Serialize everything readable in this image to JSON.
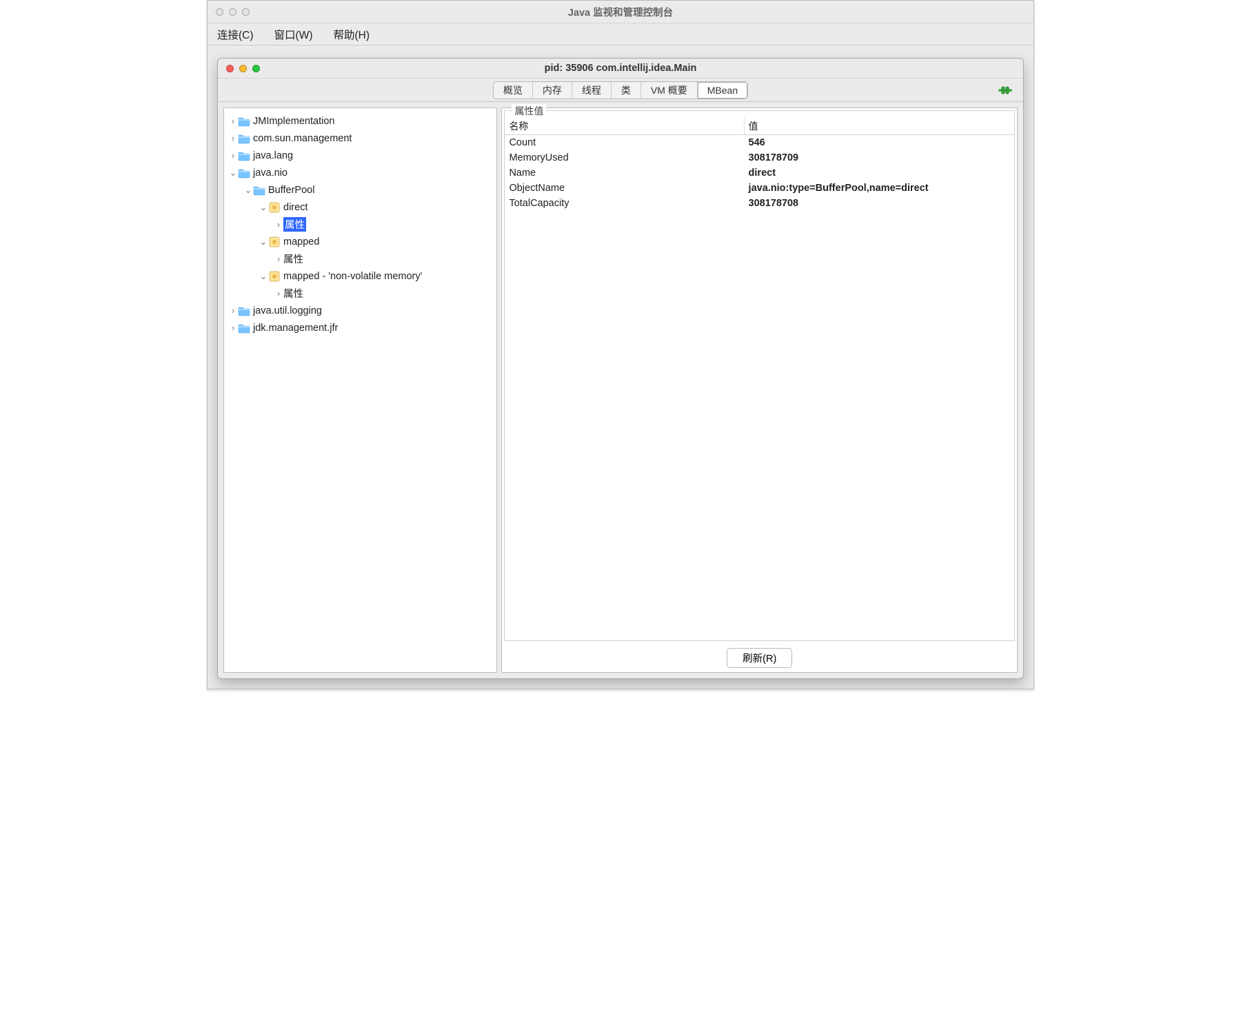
{
  "outerWindow": {
    "title": "Java 监视和管理控制台"
  },
  "menubar": {
    "connect": "连接(C)",
    "window": "窗口(W)",
    "help": "帮助(H)"
  },
  "innerWindow": {
    "title": "pid: 35906 com.intellij.idea.Main"
  },
  "tabs": {
    "overview": "概览",
    "memory": "内存",
    "threads": "线程",
    "classes": "类",
    "vmsummary": "VM 概要",
    "mbean": "MBean",
    "activeIndex": 5
  },
  "tree": {
    "attrLabel": "属性",
    "nodes": {
      "jmimpl": "JMImplementation",
      "comsun": "com.sun.management",
      "javalang": "java.lang",
      "javanio": "java.nio",
      "bufferpool": "BufferPool",
      "direct": "direct",
      "mapped": "mapped",
      "mapped_nv": "mapped - 'non-volatile memory'",
      "javalogging": "java.util.logging",
      "jdkjfr": "jdk.management.jfr"
    }
  },
  "attrPanel": {
    "legend": "属性值",
    "header": {
      "name": "名称",
      "value": "值"
    },
    "rows": [
      {
        "n": "Count",
        "v": "546"
      },
      {
        "n": "MemoryUsed",
        "v": "308178709"
      },
      {
        "n": "Name",
        "v": "direct"
      },
      {
        "n": "ObjectName",
        "v": "java.nio:type=BufferPool,name=direct"
      },
      {
        "n": "TotalCapacity",
        "v": "308178708"
      }
    ],
    "refresh": "刷新(R)"
  }
}
